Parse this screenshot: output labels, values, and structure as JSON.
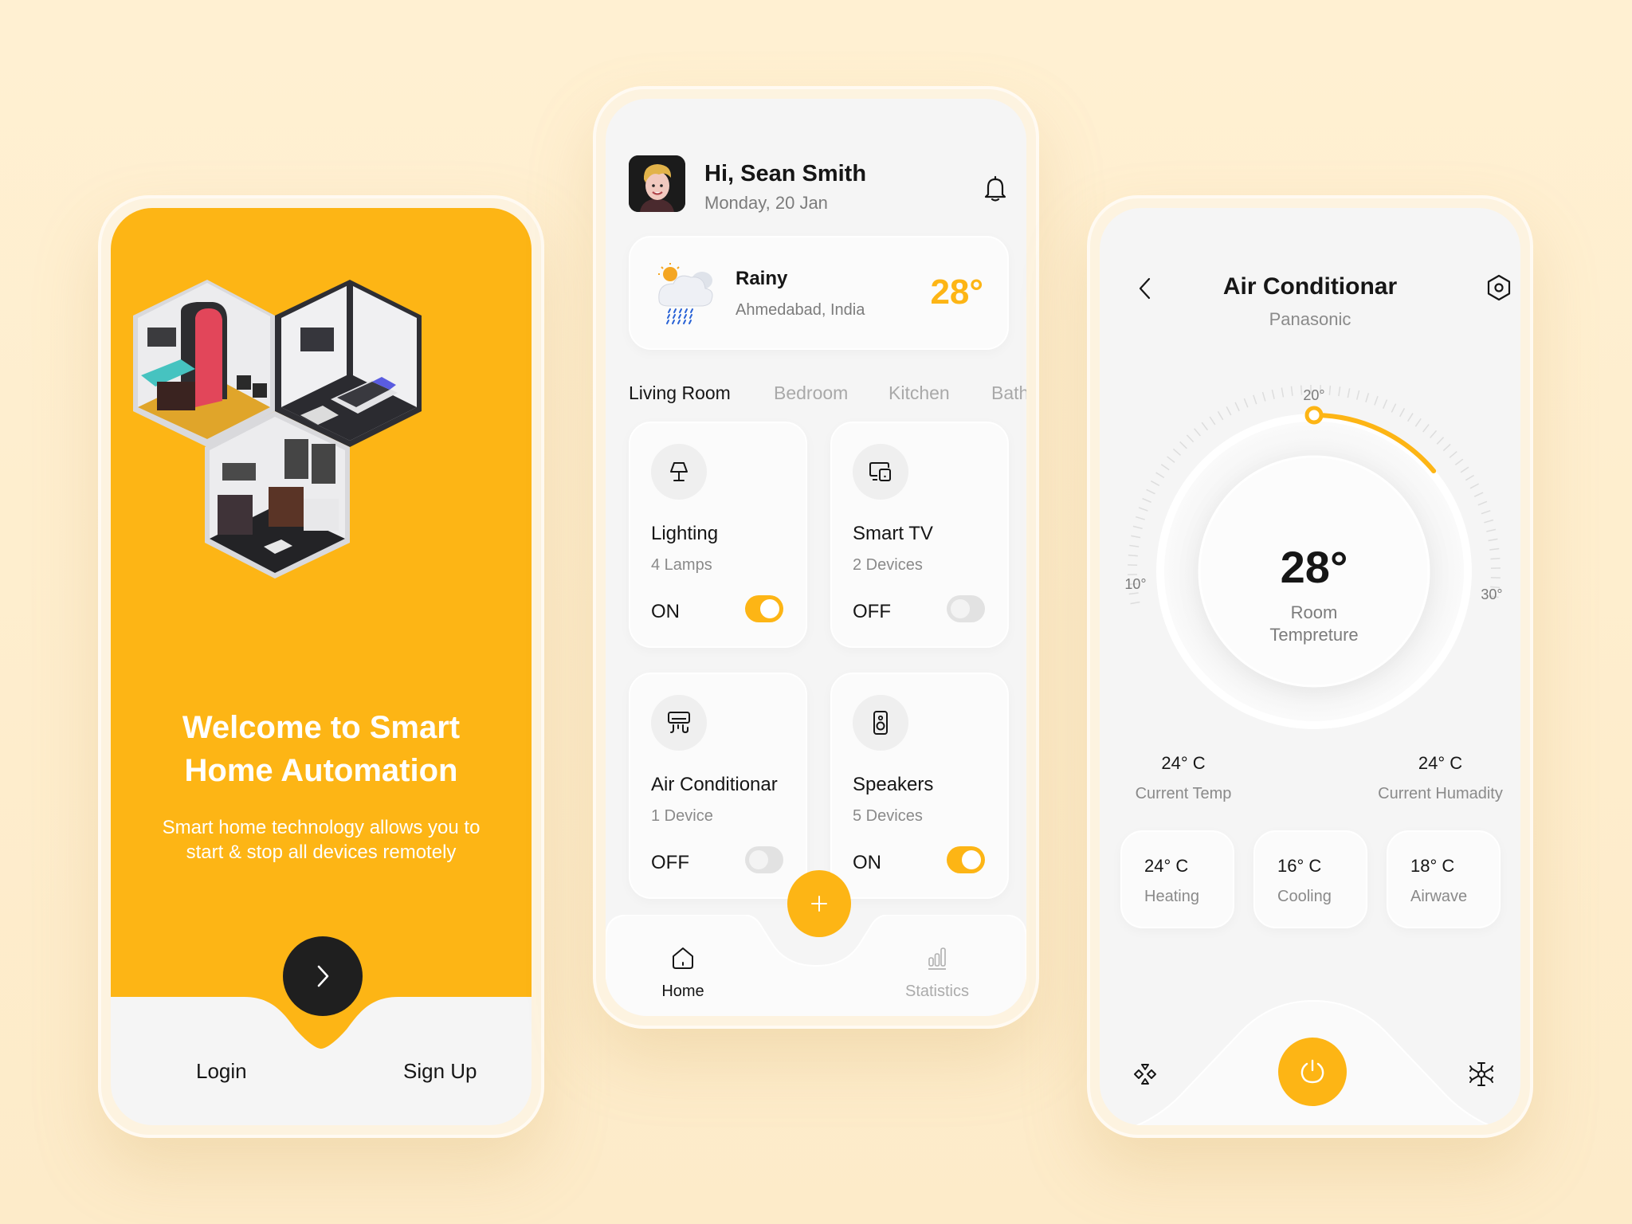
{
  "theme": {
    "accent": "#fdb515",
    "dark": "#1f1f1f",
    "background": "#fff0d2",
    "muted_text": "#8a8a8a"
  },
  "onboarding": {
    "illustration": "isometric-rooms-illustration",
    "title_line1": "Welcome to Smart",
    "title_line2": "Home Automation",
    "subtitle": "Smart home technology allows you to start & stop all devices remotely",
    "next_icon": "chevron-right-icon",
    "login_label": "Login",
    "signup_label": "Sign Up"
  },
  "dashboard": {
    "greeting": "Hi, Sean Smith",
    "date": "Monday, 20 Jan",
    "notification_icon": "bell-icon",
    "weather": {
      "condition": "Rainy",
      "location": "Ahmedabad, India",
      "temperature": "28°",
      "icon": "rain-cloud-icon"
    },
    "tabs": [
      {
        "label": "Living Room",
        "active": true
      },
      {
        "label": "Bedroom",
        "active": false
      },
      {
        "label": "Kitchen",
        "active": false
      },
      {
        "label": "Bath",
        "active": false
      }
    ],
    "devices": [
      {
        "name": "Lighting",
        "count": "4 Lamps",
        "state": "ON",
        "on": true,
        "icon": "lamp-icon"
      },
      {
        "name": "Smart TV",
        "count": "2 Devices",
        "state": "OFF",
        "on": false,
        "icon": "devices-icon"
      },
      {
        "name": "Air Conditionar",
        "count": "1 Device",
        "state": "OFF",
        "on": false,
        "icon": "air-conditioner-icon"
      },
      {
        "name": "Speakers",
        "count": "5 Devices",
        "state": "ON",
        "on": true,
        "icon": "speaker-icon"
      }
    ],
    "fab_icon": "plus-icon",
    "nav": [
      {
        "label": "Home",
        "icon": "home-icon",
        "active": true
      },
      {
        "label": "Statistics",
        "icon": "bar-chart-icon",
        "active": false
      }
    ]
  },
  "ac": {
    "title": "Air Conditionar",
    "brand": "Panasonic",
    "dial": {
      "min_label": "10°",
      "mid_label": "20°",
      "max_label": "30°",
      "min": 10,
      "max": 30,
      "arc_start": 20,
      "arc_end": 25
    },
    "room_temp": "28°",
    "room_temp_label_line1": "Room",
    "room_temp_label_line2": "Tempreture",
    "current_temp": {
      "value": "24° C",
      "label": "Current Temp"
    },
    "current_humidity": {
      "value": "24° C",
      "label": "Current Humadity"
    },
    "modes": [
      {
        "value": "24° C",
        "label": "Heating"
      },
      {
        "value": "16° C",
        "label": "Cooling"
      },
      {
        "value": "18° C",
        "label": "Airwave"
      }
    ],
    "left_icon": "fan-icon",
    "power_icon": "power-icon",
    "right_icon": "snowflake-icon"
  }
}
